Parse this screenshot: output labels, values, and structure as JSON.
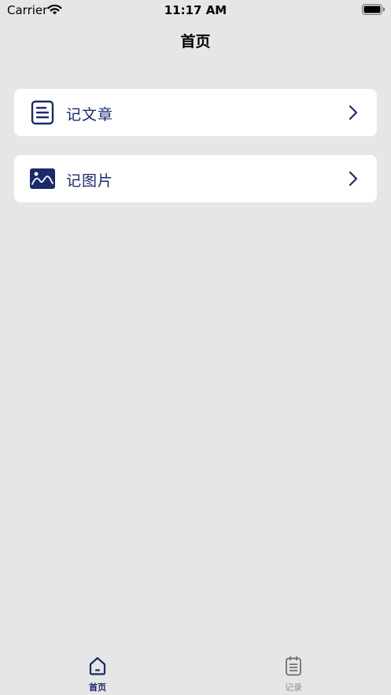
{
  "status_bar": {
    "carrier": "Carrier",
    "time": "11:17 AM",
    "wifi_icon": "wifi-icon",
    "battery_icon": "battery-icon"
  },
  "nav": {
    "title": "首页"
  },
  "menu": [
    {
      "label": "记文章",
      "icon": "document-icon"
    },
    {
      "label": "记图片",
      "icon": "image-icon"
    }
  ],
  "tabs": [
    {
      "label": "首页",
      "icon": "home-icon",
      "selected": true
    },
    {
      "label": "记录",
      "icon": "notepad-icon",
      "selected": false
    }
  ],
  "colors": {
    "accent": "#1c2a6b",
    "background": "#e6e6e6",
    "card": "#ffffff",
    "tab_inactive": "#8e8e93"
  }
}
